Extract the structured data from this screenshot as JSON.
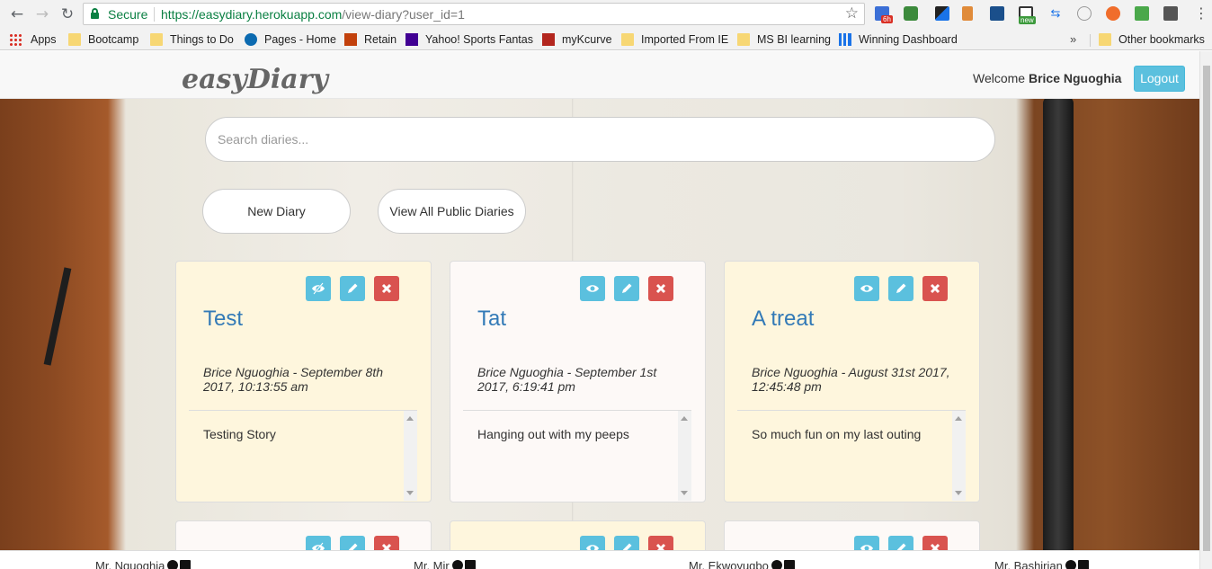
{
  "browser": {
    "secure_label": "Secure",
    "url_host": "https://easydiary.herokuapp.com",
    "url_path": "/view-diary?user_id=1",
    "extension_badge_1": "6h",
    "extension_badge_2": "new",
    "bookmarks": [
      {
        "label": "Apps",
        "icon": "apps-grid-icon"
      },
      {
        "label": "Bootcamp",
        "icon": "folder-icon"
      },
      {
        "label": "Things to Do",
        "icon": "folder-icon"
      },
      {
        "label": "Pages - Home",
        "icon": "sharepoint-icon"
      },
      {
        "label": "Retain",
        "icon": "retain-icon"
      },
      {
        "label": "Yahoo! Sports Fantas",
        "icon": "yahoo-icon"
      },
      {
        "label": "myKcurve",
        "icon": "mykcurve-icon"
      },
      {
        "label": "Imported From IE",
        "icon": "folder-icon"
      },
      {
        "label": "MS BI learning",
        "icon": "folder-icon"
      },
      {
        "label": "Winning Dashboard",
        "icon": "dashboard-icon"
      }
    ],
    "more_bookmarks": "»",
    "other_bookmarks": "Other bookmarks"
  },
  "header": {
    "brand": "easyDiary",
    "welcome_prefix": "Welcome ",
    "user_name": "Brice Nguoghia",
    "logout_label": "Logout"
  },
  "search": {
    "placeholder": "Search diaries..."
  },
  "actions": {
    "new_diary": "New Diary",
    "view_public": "View All Public Diaries"
  },
  "diaries": [
    {
      "title": "Test",
      "meta": "Brice Nguoghia - September 8th 2017, 10:13:55 am",
      "body": "Testing Story",
      "visibility": "eye-slash-icon",
      "color": "#fef6dd"
    },
    {
      "title": "Tat",
      "meta": "Brice Nguoghia - September 1st 2017, 6:19:41 pm",
      "body": "Hanging out with my peeps",
      "visibility": "eye-icon",
      "color": "#fdf9f7"
    },
    {
      "title": "A treat",
      "meta": "Brice Nguoghia - August 31st 2017, 12:45:48 pm",
      "body": "So much fun on my last outing",
      "visibility": "eye-icon",
      "color": "#fef6dd"
    }
  ],
  "footer": {
    "credits": [
      "Mr. Nguoghia",
      "Mr. Mir",
      "Mr. Ekwoyugbo",
      "Mr. Bashirian"
    ]
  },
  "colors": {
    "info": "#5bc0de",
    "danger": "#d9534f",
    "link": "#337ab7",
    "secure": "#0b8043"
  }
}
